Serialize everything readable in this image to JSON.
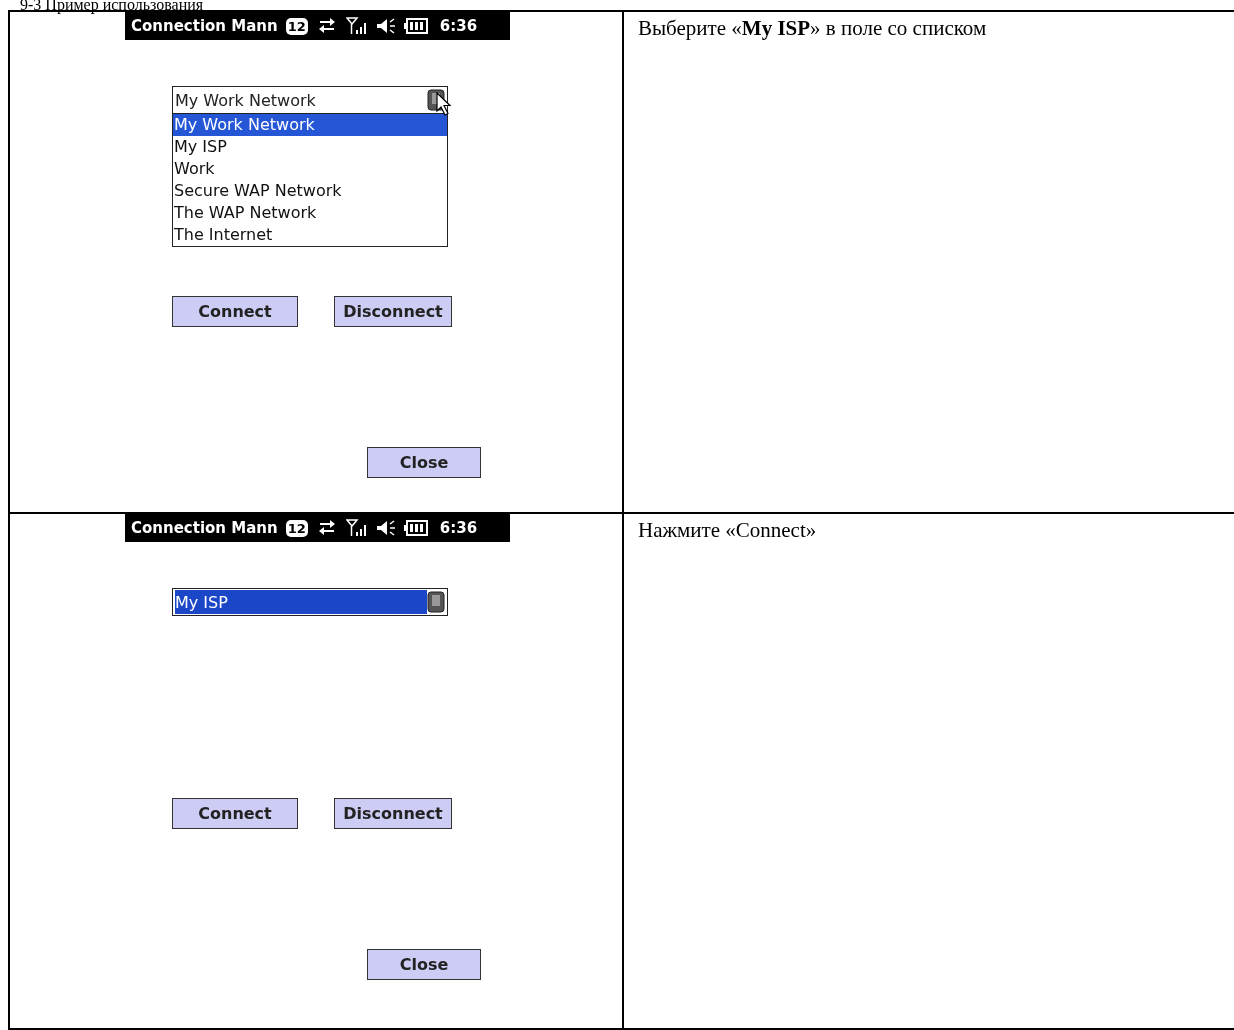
{
  "heading": "9-3 Пример использования",
  "steps": [
    {
      "screen": {
        "title": "Connection Mann",
        "badge": "12",
        "time": "6:36",
        "combo": {
          "value": "My Work Network",
          "expanded": true,
          "value_selected": false
        },
        "dropdown": [
          {
            "label": "My Work Network",
            "selected": true
          },
          {
            "label": "My ISP",
            "selected": false
          },
          {
            "label": "Work",
            "selected": false
          },
          {
            "label": "Secure WAP Network",
            "selected": false
          },
          {
            "label": "The WAP Network",
            "selected": false
          },
          {
            "label": "The Internet",
            "selected": false
          }
        ],
        "buttons": [
          "Connect",
          "Disconnect"
        ],
        "close": "Close"
      },
      "instruction": "Выберите «**My ISP**» в поле со списком"
    },
    {
      "screen": {
        "title": "Connection Mann",
        "badge": "12",
        "time": "6:36",
        "combo": {
          "value": "My ISP",
          "expanded": false,
          "value_selected": true
        },
        "buttons": [
          "Connect",
          "Disconnect"
        ],
        "close": "Close"
      },
      "instruction": "Нажмите «Connect»"
    }
  ]
}
